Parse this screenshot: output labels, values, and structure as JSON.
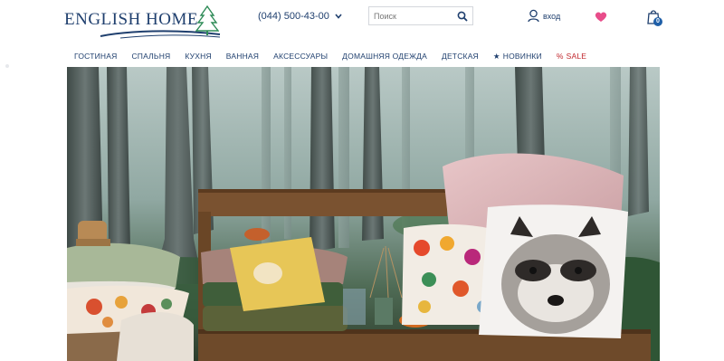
{
  "header": {
    "logo_text": "ENGLISH HOME",
    "phone": "(044) 500-43-00",
    "search_placeholder": "Поиск",
    "login_label": "вход",
    "cart_count": "0"
  },
  "nav": {
    "items": [
      {
        "label": "ГОСТИНАЯ"
      },
      {
        "label": "СПАЛЬНЯ"
      },
      {
        "label": "КУХНЯ"
      },
      {
        "label": "ВАННАЯ"
      },
      {
        "label": "АКСЕССУАРЫ"
      },
      {
        "label": "ДОМАШНЯЯ ОДЕЖДА"
      },
      {
        "label": "ДЕТСКАЯ"
      },
      {
        "label": "НОВИНКИ"
      },
      {
        "label": "SALE"
      }
    ],
    "new_symbol": "★",
    "sale_symbol": "%"
  },
  "colors": {
    "brand": "#1f3f6e",
    "sale": "#c0272d",
    "heart": "#e84d8a",
    "badge": "#1f5fa8"
  },
  "icons": {
    "tree": "tree-icon",
    "search": "search-icon",
    "user": "user-icon",
    "heart": "heart-icon",
    "cart": "shopping-bag-icon",
    "phone_dropdown": "chevron-down-icon"
  }
}
